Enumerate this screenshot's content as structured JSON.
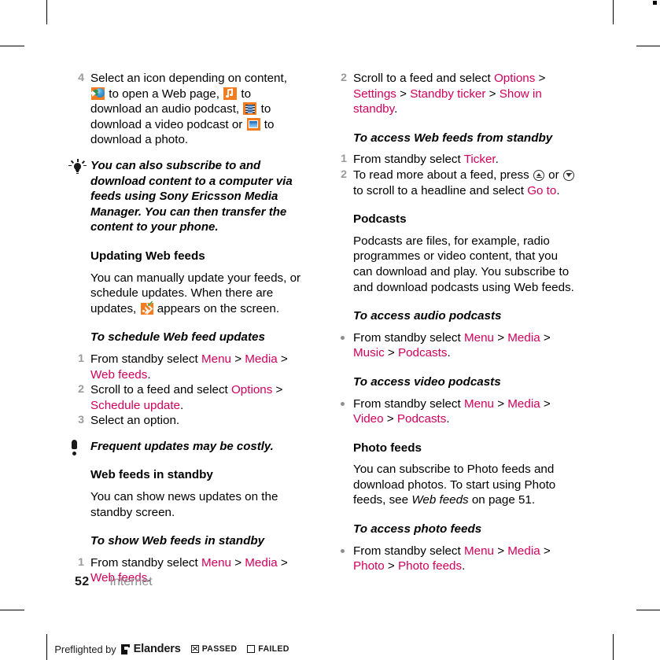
{
  "page": {
    "number": "52",
    "section": "Internet",
    "accent_color": "#d1005d",
    "icon_orange": "#f47c20"
  },
  "left_column": {
    "step4": {
      "num": "4",
      "t1": "Select an icon depending on content,",
      "t2": " to open a Web page, ",
      "t3": " to download an audio podcast, ",
      "t4": " to download a video podcast or ",
      "t5": " to download a photo."
    },
    "tip": {
      "icon": "lightbulb-icon",
      "text": "You can also subscribe to and download content to a computer via feeds using Sony Ericsson Media Manager. You can then transfer the content to your phone."
    },
    "updating_heading": "Updating Web feeds",
    "updating_body_1": "You can manually update your feeds, or schedule updates. When there are updates, ",
    "updating_body_2": " appears on the screen.",
    "schedule_heading": "To schedule Web feed updates",
    "schedule_steps": [
      {
        "num": "1",
        "parts": [
          {
            "text": "From standby select ",
            "style": "plain"
          },
          {
            "text": "Menu",
            "style": "menu"
          },
          {
            "text": " > ",
            "style": "plain"
          },
          {
            "text": "Media",
            "style": "menu"
          },
          {
            "text": " > ",
            "style": "plain"
          },
          {
            "text": "Web feeds",
            "style": "menu"
          },
          {
            "text": ".",
            "style": "plain"
          }
        ]
      },
      {
        "num": "2",
        "parts": [
          {
            "text": "Scroll to a feed and select ",
            "style": "plain"
          },
          {
            "text": "Options",
            "style": "menu"
          },
          {
            "text": " > ",
            "style": "plain"
          },
          {
            "text": "Schedule update",
            "style": "menu"
          },
          {
            "text": ".",
            "style": "plain"
          }
        ]
      },
      {
        "num": "3",
        "parts": [
          {
            "text": "Select an option.",
            "style": "plain"
          }
        ]
      }
    ],
    "note": {
      "icon": "exclamation-icon",
      "text": "Frequent updates may be costly."
    },
    "standby_heading": "Web feeds in standby",
    "standby_body": "You can show news updates on the standby screen.",
    "show_heading": "To show Web feeds in standby",
    "show_steps": [
      {
        "num": "1",
        "parts": [
          {
            "text": "From standby select ",
            "style": "plain"
          },
          {
            "text": "Menu",
            "style": "menu"
          },
          {
            "text": " > ",
            "style": "plain"
          },
          {
            "text": "Media",
            "style": "menu"
          },
          {
            "text": " > ",
            "style": "plain"
          },
          {
            "text": "Web feeds",
            "style": "menu"
          },
          {
            "text": ".",
            "style": "plain"
          }
        ]
      }
    ]
  },
  "right_column": {
    "step2": {
      "num": "2",
      "parts": [
        {
          "text": "Scroll to a feed and select ",
          "style": "plain"
        },
        {
          "text": "Options",
          "style": "menu"
        },
        {
          "text": " > ",
          "style": "plain"
        },
        {
          "text": "Settings",
          "style": "menu"
        },
        {
          "text": " > ",
          "style": "plain"
        },
        {
          "text": "Standby ticker",
          "style": "menu"
        },
        {
          "text": " > ",
          "style": "plain"
        },
        {
          "text": "Show in standby",
          "style": "menu"
        },
        {
          "text": ".",
          "style": "plain"
        }
      ]
    },
    "access_standby_heading": "To access Web feeds from standby",
    "access_standby_step1": {
      "num": "1",
      "parts": [
        {
          "text": "From standby select ",
          "style": "plain"
        },
        {
          "text": "Ticker",
          "style": "menu"
        },
        {
          "text": ".",
          "style": "plain"
        }
      ]
    },
    "access_standby_step2": {
      "num": "2",
      "t1": "To read more about a feed, press ",
      "t2": " or ",
      "t3": " to scroll to a headline and select ",
      "t4": "Go to",
      "t5": "."
    },
    "podcasts_heading": "Podcasts",
    "podcasts_body": "Podcasts are files, for example, radio programmes or video content, that you can download and play. You subscribe to and download podcasts using Web feeds.",
    "audio_heading": "To access audio podcasts",
    "audio_step": {
      "parts": [
        {
          "text": "From standby select ",
          "style": "plain"
        },
        {
          "text": "Menu",
          "style": "menu"
        },
        {
          "text": " > ",
          "style": "plain"
        },
        {
          "text": "Media",
          "style": "menu"
        },
        {
          "text": " > ",
          "style": "plain"
        },
        {
          "text": "Music",
          "style": "menu"
        },
        {
          "text": " > ",
          "style": "plain"
        },
        {
          "text": "Podcasts",
          "style": "menu"
        },
        {
          "text": ".",
          "style": "plain"
        }
      ]
    },
    "video_heading": "To access video podcasts",
    "video_step": {
      "parts": [
        {
          "text": "From standby select ",
          "style": "plain"
        },
        {
          "text": "Menu",
          "style": "menu"
        },
        {
          "text": " > ",
          "style": "plain"
        },
        {
          "text": "Media",
          "style": "menu"
        },
        {
          "text": " > ",
          "style": "plain"
        },
        {
          "text": "Video",
          "style": "menu"
        },
        {
          "text": " > ",
          "style": "plain"
        },
        {
          "text": "Podcasts",
          "style": "menu"
        },
        {
          "text": ".",
          "style": "plain"
        }
      ]
    },
    "photo_heading": "Photo feeds",
    "photo_body_1": "You can subscribe to Photo feeds and download photos. To start using Photo feeds, see ",
    "photo_body_ital": "Web feeds",
    "photo_body_2": " on page 51.",
    "photo_access_heading": "To access photo feeds",
    "photo_step": {
      "parts": [
        {
          "text": "From standby select ",
          "style": "plain"
        },
        {
          "text": "Menu",
          "style": "menu"
        },
        {
          "text": " > ",
          "style": "plain"
        },
        {
          "text": "Media",
          "style": "menu"
        },
        {
          "text": " > ",
          "style": "plain"
        },
        {
          "text": "Photo",
          "style": "menu"
        },
        {
          "text": " > ",
          "style": "plain"
        },
        {
          "text": "Photo feeds",
          "style": "menu"
        },
        {
          "text": ".",
          "style": "plain"
        }
      ]
    }
  },
  "preflight": {
    "prefix": "Preflighted by",
    "brand": "Elanders",
    "passed_label": "PASSED",
    "failed_label": "FAILED"
  }
}
